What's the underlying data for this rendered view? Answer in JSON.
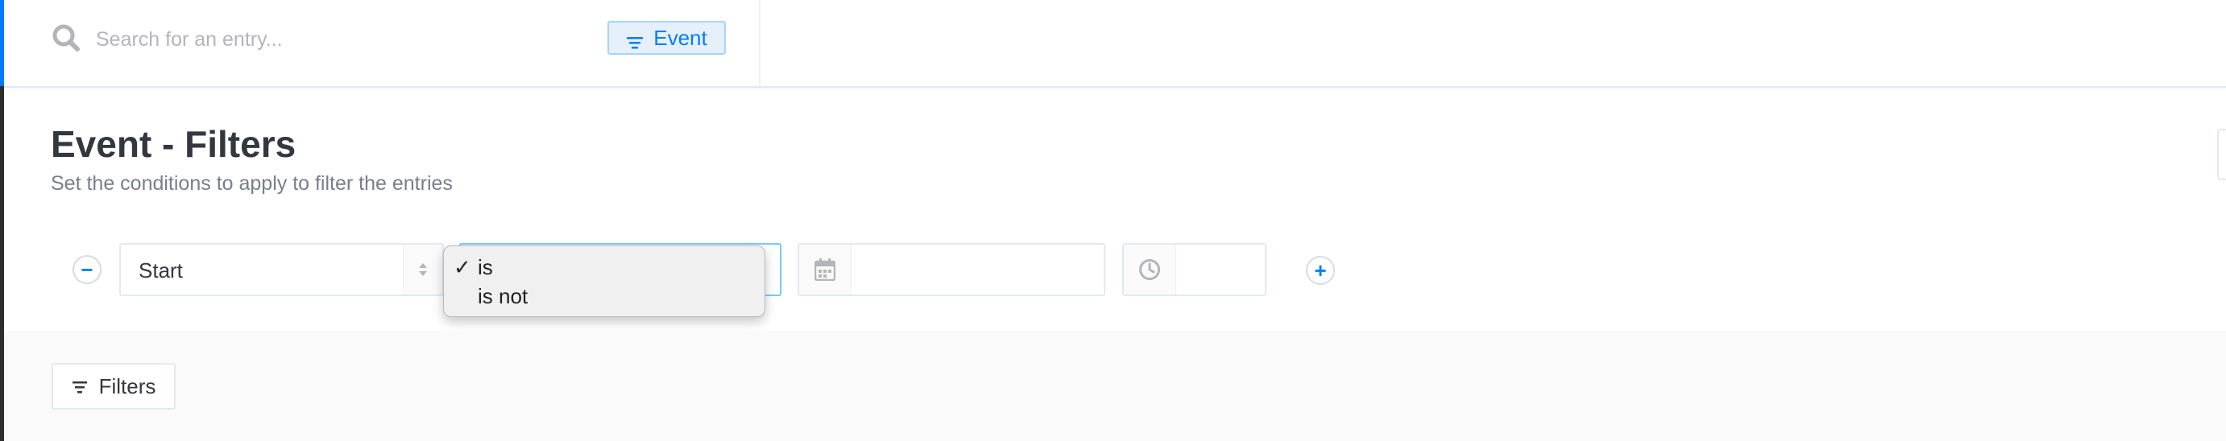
{
  "search": {
    "placeholder": "Search for an entry..."
  },
  "header": {
    "chip_label": "Event"
  },
  "main": {
    "title": "Event - Filters",
    "subtitle": "Set the conditions to apply to filter the entries"
  },
  "filter": {
    "field_value": "Start",
    "operator_options": [
      {
        "label": "is",
        "selected": true
      },
      {
        "label": "is not",
        "selected": false
      }
    ],
    "check_mark": "✓",
    "remove_symbol": "−",
    "add_symbol": "+"
  },
  "footer": {
    "filters_button_label": "Filters"
  },
  "colors": {
    "accent": "#007eff",
    "chip_bg": "#e6f0fb",
    "title_text": "#333740",
    "muted_text": "#787e8f"
  },
  "icons": {
    "search": "search-icon",
    "filter": "filter-lines-icon",
    "calendar": "calendar-icon",
    "clock": "clock-icon",
    "sort_arrows": "sort-arrows-icon"
  }
}
